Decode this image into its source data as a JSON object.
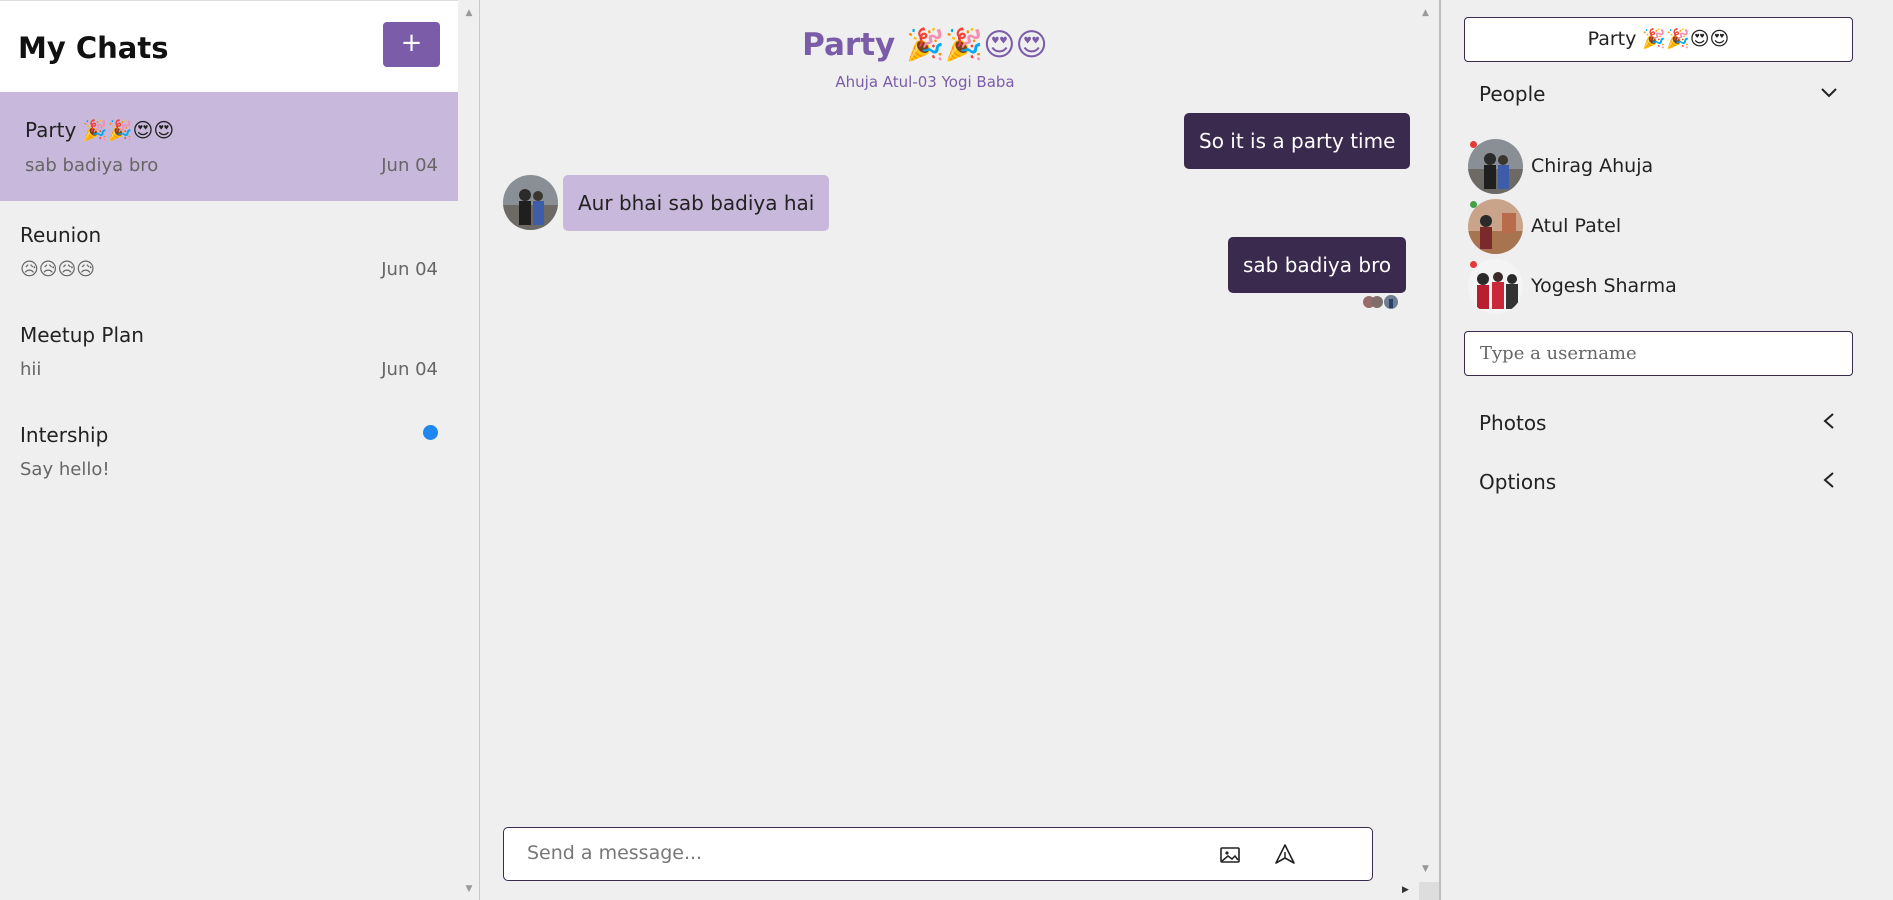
{
  "sidebar": {
    "title": "My Chats",
    "new_chat_label": "+",
    "chats": [
      {
        "name": "Party 🎉🎉😍😍",
        "preview": "sab badiya bro",
        "date": "Jun 04",
        "active": true
      },
      {
        "name": "Reunion",
        "preview": "😥😥😥😥",
        "date": "Jun 04"
      },
      {
        "name": "Meetup Plan",
        "preview": "hii",
        "date": "Jun 04"
      },
      {
        "name": "Intership",
        "preview": "Say hello!",
        "date": "",
        "unread": true
      }
    ]
  },
  "chat": {
    "title": "Party 🎉🎉😍😍",
    "members": "Ahuja Atul-03 Yogi Baba",
    "messages": [
      {
        "text": "So it is a party time",
        "direction": "out"
      },
      {
        "text": "Aur bhai sab badiya hai",
        "direction": "in"
      },
      {
        "text": "sab badiya bro",
        "direction": "out"
      }
    ],
    "composer_placeholder": "Send a message...",
    "icons": {
      "image": "image-icon",
      "send": "send-icon"
    }
  },
  "details": {
    "title": "Party 🎉🎉😍😍",
    "people_label": "People",
    "people": [
      {
        "name": "Chirag Ahuja",
        "status": "offline",
        "status_color": "#e53935"
      },
      {
        "name": "Atul Patel",
        "status": "online",
        "status_color": "#43a047"
      },
      {
        "name": "Yogesh Sharma",
        "status": "offline",
        "status_color": "#e53935"
      }
    ],
    "username_placeholder": "Type a username",
    "photos_label": "Photos",
    "options_label": "Options"
  },
  "colors": {
    "accent": "#7b5ca8",
    "active_chat": "#c8b9dc",
    "outgoing_bubble": "#3a2a4e",
    "incoming_bubble": "#c8b9dc",
    "unread": "#1e88f0"
  }
}
